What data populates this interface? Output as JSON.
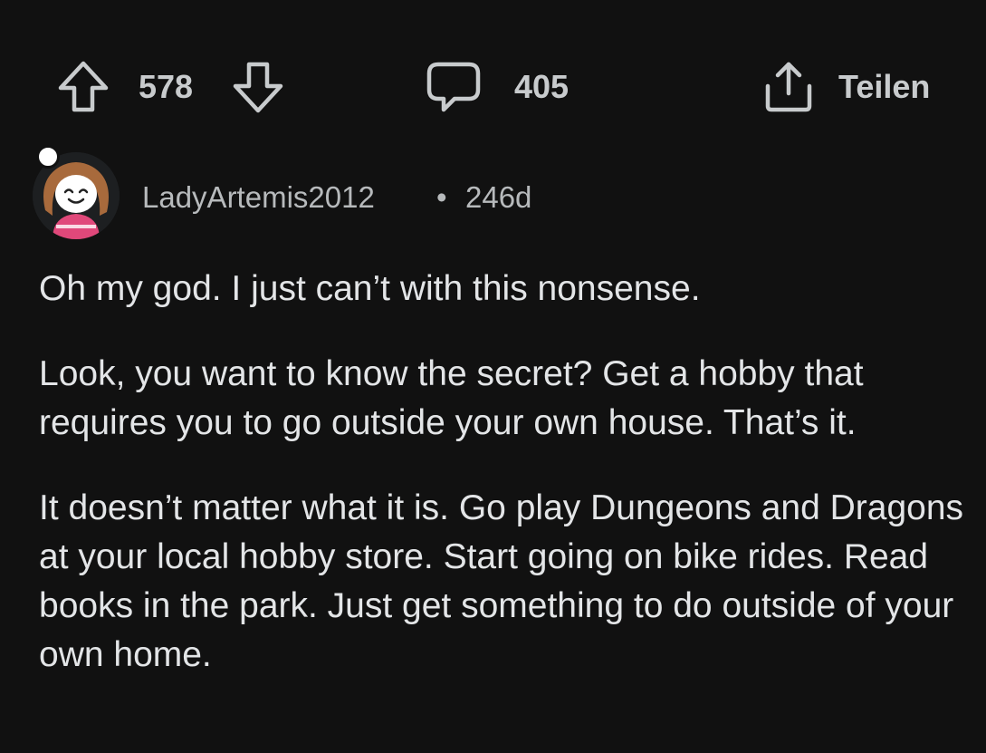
{
  "actions": {
    "vote_count": "578",
    "comments_count": "405",
    "share_label": "Teilen"
  },
  "comment": {
    "username": "LadyArtemis2012",
    "separator": "•",
    "age": "246d",
    "paragraphs": [
      "Oh my god. I just can’t with this nonsense.",
      "Look, you want to know the secret? Get a hobby that requires you to go outside your own house. That’s it.",
      "It doesn’t matter what it is. Go play Dungeons and Dragons at your local hobby store. Start going on bike rides. Read books in the park. Just get something to do outside of your own home."
    ]
  },
  "icons": {
    "upvote": "arrow-up-outline-icon",
    "downvote": "arrow-down-outline-icon",
    "comments": "speech-bubble-icon",
    "share": "share-upload-icon"
  },
  "colors": {
    "background": "#111111",
    "text": "#e3e5e7",
    "muted": "#b7babc",
    "avatar_shirt": "#e0487a"
  }
}
